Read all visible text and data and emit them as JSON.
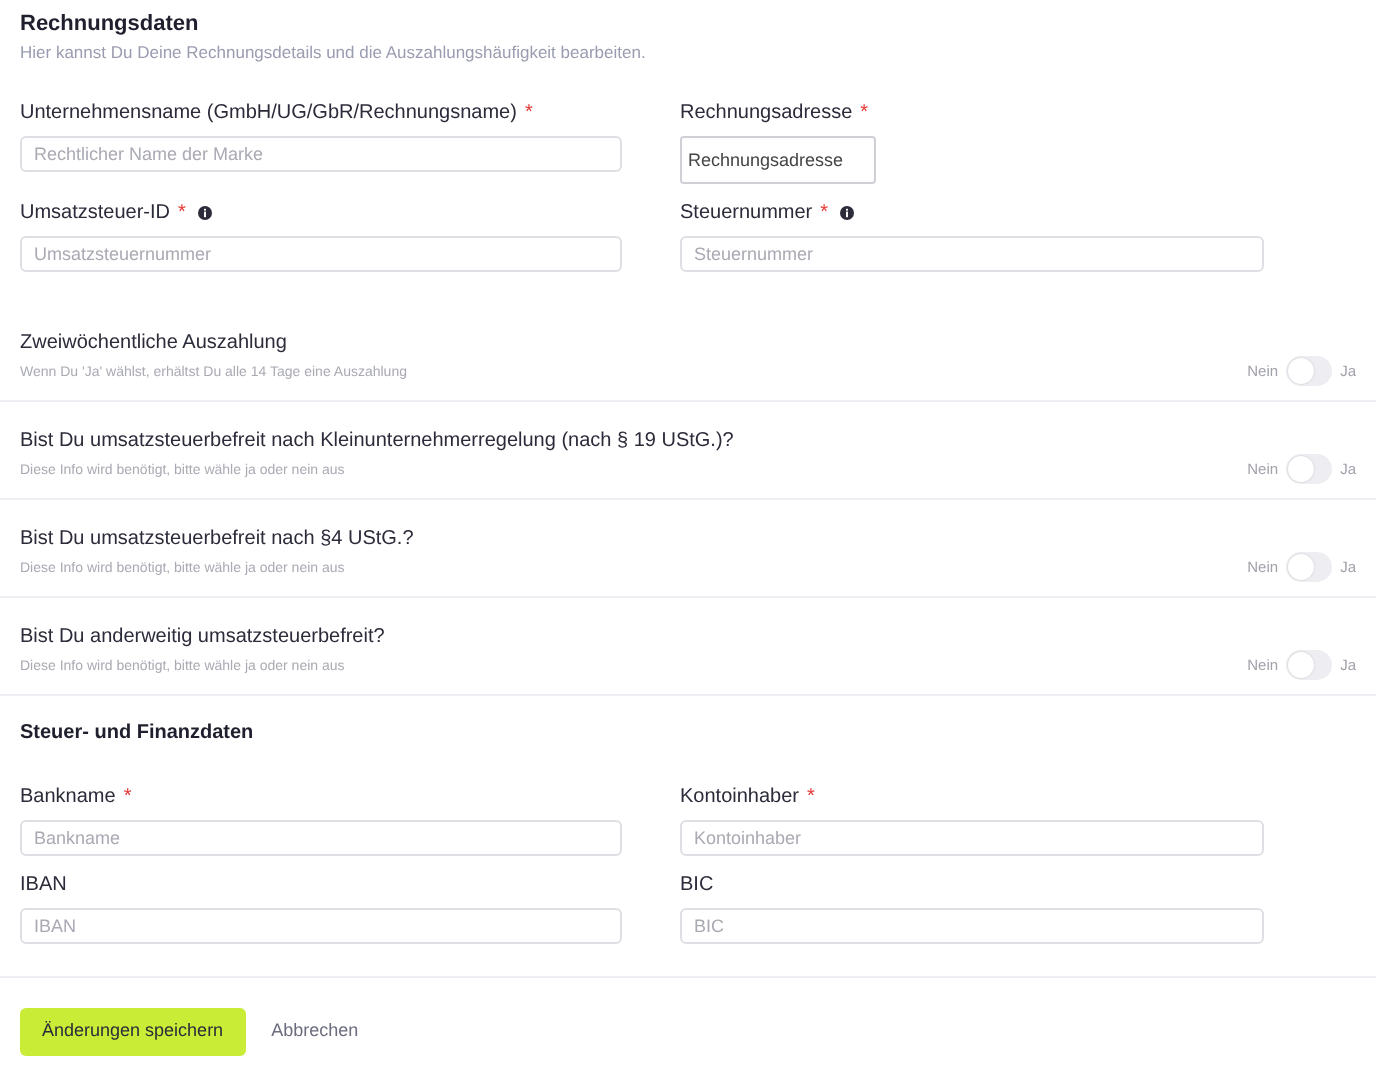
{
  "billing": {
    "title": "Rechnungsdaten",
    "subtitle": "Hier kannst Du Deine Rechnungsdetails und die Auszahlungshäufigkeit bearbeiten.",
    "fields": [
      {
        "label": "Unternehmensname (GmbH/UG/GbR/Rechnungsname)",
        "required_mark": "*",
        "placeholder": "Rechtlicher Name der Marke",
        "kind": "wide"
      },
      {
        "label": "Rechnungsadresse",
        "required_mark": "*",
        "value": "Rechnungsadresse",
        "kind": "compact"
      },
      {
        "label": "Umsatzsteuer-ID",
        "required_mark": "*",
        "info_icon": true,
        "placeholder": "Umsatzsteuernummer",
        "kind": "wide"
      },
      {
        "label": "Steuernummer",
        "required_mark": "*",
        "info_icon": true,
        "placeholder": "Steuernummer",
        "kind": "wide"
      }
    ]
  },
  "toggles": [
    {
      "title": "Zweiwöchentliche Auszahlung",
      "hint": "Wenn Du 'Ja' wählst, erhältst Du alle 14 Tage eine Auszahlung",
      "off_label": "Nein",
      "on_label": "Ja",
      "on": false
    },
    {
      "title": "Bist Du umsatzsteuerbefreit nach Kleinunternehmerregelung (nach § 19 UStG.)?",
      "hint": "Diese Info wird benötigt, bitte wähle ja oder nein aus",
      "off_label": "Nein",
      "on_label": "Ja",
      "on": false
    },
    {
      "title": "Bist Du umsatzsteuerbefreit nach §4 UStG.?",
      "hint": "Diese Info wird benötigt, bitte wähle ja oder nein aus",
      "off_label": "Nein",
      "on_label": "Ja",
      "on": false
    },
    {
      "title": "Bist Du anderweitig umsatzsteuerbefreit?",
      "hint": "Diese Info wird benötigt, bitte wähle ja oder nein aus",
      "off_label": "Nein",
      "on_label": "Ja",
      "on": false
    }
  ],
  "finance": {
    "title": "Steuer- und Finanzdaten",
    "fields": [
      {
        "label": "Bankname",
        "required_mark": "*",
        "placeholder": "Bankname",
        "kind": "wide"
      },
      {
        "label": "Kontoinhaber",
        "required_mark": "*",
        "placeholder": "Kontoinhaber",
        "kind": "wide"
      },
      {
        "label": "IBAN",
        "placeholder": "IBAN",
        "kind": "wide"
      },
      {
        "label": "BIC",
        "placeholder": "BIC",
        "kind": "wide"
      }
    ]
  },
  "actions": {
    "save": "Änderungen speichern",
    "cancel": "Abbrechen"
  }
}
